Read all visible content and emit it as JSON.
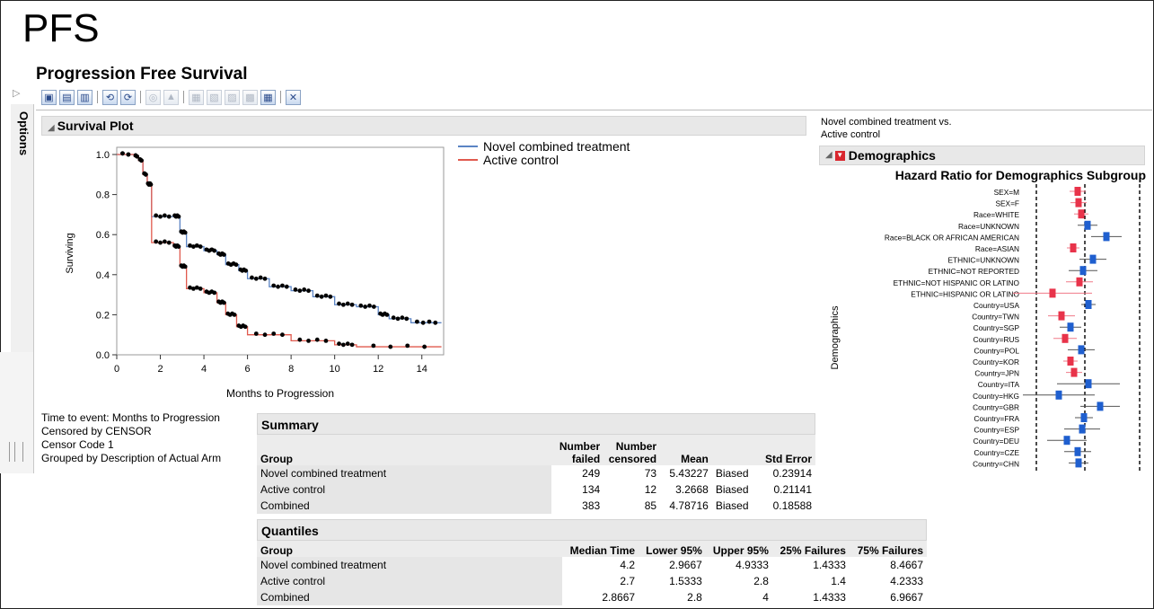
{
  "page_title": "PFS",
  "window": {
    "title": "Progression Free Survival",
    "sidebar_label": "Options",
    "toolbar_icons": [
      "save-icon",
      "save-as-icon",
      "print-icon",
      "copy-icon",
      "paste-icon",
      "zoom-icon",
      "image-icon",
      "report-icon",
      "script-icon",
      "data-icon",
      "chart-icon",
      "table-icon",
      "close-icon"
    ]
  },
  "survival_plot": {
    "header": "Survival Plot",
    "legend": [
      {
        "label": "Novel combined treatment",
        "color": "#5b84c4"
      },
      {
        "label": "Active control",
        "color": "#e05a4e"
      }
    ],
    "y_axis_label": "Surviving",
    "x_axis_label": "Months to Progression",
    "y_ticks": [
      "1.0",
      "0.8",
      "0.6",
      "0.4",
      "0.2",
      "0.0"
    ],
    "x_ticks": [
      "0",
      "2",
      "4",
      "6",
      "8",
      "10",
      "12",
      "14"
    ]
  },
  "chart_data": {
    "type": "line",
    "xlabel": "Months to Progression",
    "ylabel": "Surviving",
    "xlim": [
      0,
      15
    ],
    "ylim": [
      0,
      1
    ],
    "series": [
      {
        "name": "Novel combined treatment",
        "color": "#5b84c4",
        "x": [
          0,
          0.8,
          1.0,
          1.2,
          1.4,
          1.6,
          2.6,
          2.9,
          3.2,
          4.0,
          4.6,
          5.0,
          5.6,
          6.0,
          7.0,
          8.0,
          9.0,
          10.0,
          11.0,
          12.0,
          12.5,
          13.5,
          14.9
        ],
        "y": [
          1.0,
          0.99,
          0.97,
          0.9,
          0.85,
          0.69,
          0.69,
          0.61,
          0.54,
          0.52,
          0.5,
          0.45,
          0.42,
          0.38,
          0.34,
          0.32,
          0.29,
          0.25,
          0.24,
          0.2,
          0.18,
          0.16,
          0.16
        ]
      },
      {
        "name": "Active control",
        "color": "#e05a4e",
        "x": [
          0,
          0.8,
          1.0,
          1.2,
          1.4,
          1.6,
          2.6,
          2.9,
          3.2,
          4.0,
          4.6,
          5.0,
          5.5,
          6.0,
          8.0,
          10.0,
          11.0,
          14.9
        ],
        "y": [
          1.0,
          0.99,
          0.97,
          0.9,
          0.85,
          0.56,
          0.54,
          0.44,
          0.33,
          0.31,
          0.26,
          0.2,
          0.14,
          0.1,
          0.07,
          0.05,
          0.04,
          0.04
        ]
      }
    ]
  },
  "event_info": [
    "Time to event: Months to Progression",
    "Censored by CENSOR",
    "Censor Code 1",
    "Grouped by Description of Actual Arm"
  ],
  "summary": {
    "title": "Summary",
    "columns": {
      "group": "Group",
      "failed_1": "Number",
      "failed_2": "failed",
      "censored_1": "Number",
      "censored_2": "censored",
      "mean": "Mean",
      "blank": "",
      "std": "Std Error"
    },
    "rows": [
      {
        "group": "Novel combined treatment",
        "failed": "249",
        "censored": "73",
        "mean": "5.43227",
        "note": "Biased",
        "std": "0.23914"
      },
      {
        "group": "Active control",
        "failed": "134",
        "censored": "12",
        "mean": "3.2668",
        "note": "Biased",
        "std": "0.21141"
      },
      {
        "group": "Combined",
        "failed": "383",
        "censored": "85",
        "mean": "4.78716",
        "note": "Biased",
        "std": "0.18588"
      }
    ]
  },
  "quantiles": {
    "title": "Quantiles",
    "columns": [
      "Group",
      "Median Time",
      "Lower 95%",
      "Upper 95%",
      "25% Failures",
      "75% Failures"
    ],
    "rows": [
      [
        "Novel combined treatment",
        "4.2",
        "2.9667",
        "4.9333",
        "1.4333",
        "8.4667"
      ],
      [
        "Active control",
        "2.7",
        "1.5333",
        "2.8",
        "1.4",
        "4.2333"
      ],
      [
        "Combined",
        "2.8667",
        "2.8",
        "4",
        "1.4333",
        "6.9667"
      ]
    ]
  },
  "demographics": {
    "caption_line1": "Novel combined treatment  vs.",
    "caption_line2": "Active control",
    "header": "Demographics",
    "plot_title": "Hazard Ratio for Demographics Subgroup",
    "axis_label": "Demographics",
    "subgroups": [
      {
        "label": "SEX=M",
        "color": "#e8334a"
      },
      {
        "label": "SEX=F",
        "color": "#e8334a"
      },
      {
        "label": "Race=WHITE",
        "color": "#e8334a"
      },
      {
        "label": "Race=UNKNOWN",
        "color": "#1f5fcf"
      },
      {
        "label": "Race=BLACK OR AFRICAN AMERICAN",
        "color": "#1f5fcf"
      },
      {
        "label": "Race=ASIAN",
        "color": "#e8334a"
      },
      {
        "label": "ETHNIC=UNKNOWN",
        "color": "#1f5fcf"
      },
      {
        "label": "ETHNIC=NOT REPORTED",
        "color": "#1f5fcf"
      },
      {
        "label": "ETHNIC=NOT HISPANIC OR LATINO",
        "color": "#e8334a"
      },
      {
        "label": "ETHNIC=HISPANIC OR LATINO",
        "color": "#e8334a"
      },
      {
        "label": "Country=USA",
        "color": "#1f5fcf"
      },
      {
        "label": "Country=TWN",
        "color": "#e8334a"
      },
      {
        "label": "Country=SGP",
        "color": "#1f5fcf"
      },
      {
        "label": "Country=RUS",
        "color": "#e8334a"
      },
      {
        "label": "Country=POL",
        "color": "#1f5fcf"
      },
      {
        "label": "Country=KOR",
        "color": "#e8334a"
      },
      {
        "label": "Country=JPN",
        "color": "#e8334a"
      },
      {
        "label": "Country=ITA",
        "color": "#1f5fcf"
      },
      {
        "label": "Country=HKG",
        "color": "#1f5fcf"
      },
      {
        "label": "Country=GBR",
        "color": "#1f5fcf"
      },
      {
        "label": "Country=FRA",
        "color": "#1f5fcf"
      },
      {
        "label": "Country=ESP",
        "color": "#1f5fcf"
      },
      {
        "label": "Country=DEU",
        "color": "#1f5fcf"
      },
      {
        "label": "Country=CZE",
        "color": "#1f5fcf"
      },
      {
        "label": "Country=CHN",
        "color": "#1f5fcf"
      }
    ]
  }
}
